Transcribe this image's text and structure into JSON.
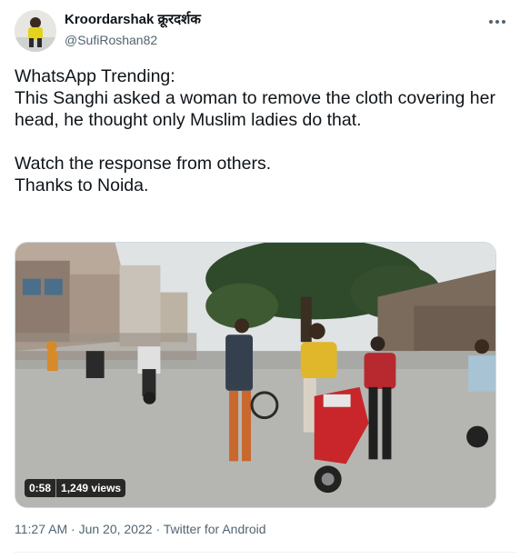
{
  "author": {
    "display_name": "Kroordarshak क्रूरदर्शक",
    "handle": "@SufiRoshan82"
  },
  "tweet": {
    "lines": [
      "WhatsApp Trending:",
      "This Sanghi asked a woman to remove the cloth covering her head, he thought only Muslim ladies do that.",
      "Watch the response from others.",
      "Thanks to Noida."
    ]
  },
  "media": {
    "duration": "0:58",
    "views": "1,249 views"
  },
  "meta": {
    "time": "11:27 AM",
    "separator": "·",
    "date": "Jun 20, 2022",
    "source": "Twitter for Android"
  },
  "icons": {
    "more": "more-horizontal-icon"
  },
  "colors": {
    "text_primary": "#0f1419",
    "text_secondary": "#536471",
    "border": "#cfd9de",
    "scooter_red": "#c8262a"
  }
}
